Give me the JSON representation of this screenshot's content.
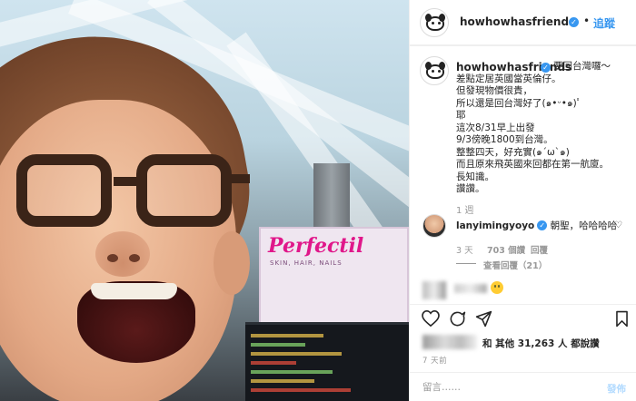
{
  "header": {
    "username": "howhowhasfriends",
    "verified_icon": "verified-badge-icon",
    "separator": "•",
    "follow_label": "追蹤",
    "more_label": "···"
  },
  "caption": {
    "username": "howhowhasfriends",
    "lines": [
      "要回台灣囉～",
      "差點定居英國當英倫仔。",
      "但發現物價很貴，",
      "所以還是回台灣好了(๑•ᵕ•๑)ﾟ",
      "耶",
      "這次8/31早上出發",
      "9/3傍晚1800到台灣。",
      "整整四天，好充實(๑´ω`๑)",
      "而且原來飛英國來回都在第一航廈。",
      "長知識。",
      "讚讚。"
    ],
    "time": "1 週"
  },
  "comment": {
    "username": "lanyimingyoyo",
    "verified_icon": "verified-badge-icon",
    "text": " 朝聖，哈哈哈哈",
    "time": "3 天",
    "likes": "703 個讚",
    "reply": "回覆",
    "view_replies": "查看回覆（21）"
  },
  "actions": {
    "like_icon": "heart-icon",
    "comment_icon": "comment-icon",
    "share_icon": "share-icon",
    "save_icon": "bookmark-icon"
  },
  "likes": {
    "text": "和 其他 31,263 人 都說讚"
  },
  "posted": "7 天前",
  "comment_box": {
    "placeholder": "留言……",
    "post_label": "發佈"
  },
  "photo": {
    "banner_title": "Perfectil",
    "banner_sub": "SKIN, HAIR, NAILS"
  },
  "colors": {
    "accent": "#3897f0",
    "text": "#262626",
    "muted": "#999999",
    "post_disabled": "#b3dbff"
  }
}
